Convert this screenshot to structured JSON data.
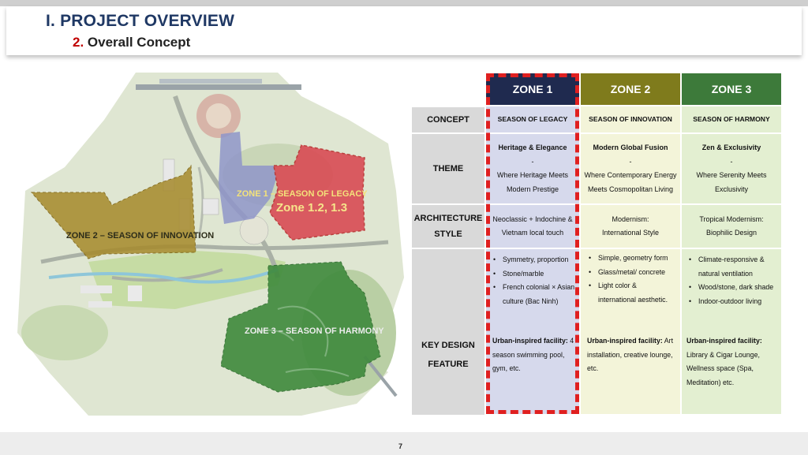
{
  "header": {
    "title": "I. PROJECT OVERVIEW",
    "subtitle_num": "2.",
    "subtitle": "Overall Concept"
  },
  "map": {
    "zone1_label": "ZONE 1 – SEASON OF LEGACY",
    "zone1_sub": "Zone 1.2, 1.3",
    "zone2_label": "ZONE 2 – SEASON OF INNOVATION",
    "zone3_label": "ZONE 3 – SEASON OF HARMONY"
  },
  "table": {
    "zones": [
      "ZONE 1",
      "ZONE 2",
      "ZONE 3"
    ],
    "zone_colors": [
      "#1f2a4f",
      "#7f7b1c",
      "#3d7a3a"
    ],
    "row_labels": {
      "concept": "CONCEPT",
      "theme": "THEME",
      "arch_1": "ARCHITECTURE",
      "arch_2": "STYLE",
      "key_1": "KEY DESIGN",
      "key_2": "FEATURE"
    },
    "concept": [
      "SEASON OF LEGACY",
      "SEASON OF INNOVATION",
      "SEASON OF HARMONY"
    ],
    "theme": [
      {
        "title": "Heritage & Elegance",
        "dash": "-",
        "line1": "Where Heritage Meets",
        "line2": "Modern Prestige"
      },
      {
        "title": "Modern Global Fusion",
        "dash": "-",
        "line1": "Where Contemporary Energy",
        "line2": "Meets Cosmopolitan Living"
      },
      {
        "title": "Zen & Exclusivity",
        "dash": "-",
        "line1": "Where Serenity Meets",
        "line2": "Exclusivity"
      }
    ],
    "arch": [
      {
        "line1": "Neoclassic + Indochine &",
        "line2": "Vietnam local touch"
      },
      {
        "line1": "Modernism:",
        "line2": "International  Style"
      },
      {
        "line1": "Tropical Modernism:",
        "line2": "Biophilic Design"
      }
    ],
    "key": [
      {
        "bullets": [
          "Symmetry, proportion",
          "Stone/marble",
          "French colonial × Asian",
          "culture (Bac Ninh)"
        ],
        "facility_label": "Urban-inspired facility:",
        "facility_text1": " 4",
        "facility_text2": "season swimming pool,",
        "facility_text3": "gym, etc."
      },
      {
        "bullets": [
          "Simple, geometry form",
          "Glass/metal/ concrete",
          "Light color &",
          "international aesthetic."
        ],
        "facility_label": "Urban-inspired facility:",
        "facility_text1": " Art",
        "facility_text2": "installation, creative lounge,",
        "facility_text3": "etc."
      },
      {
        "bullets": [
          "Climate-responsive &",
          "natural ventilation",
          "Wood/stone,  dark shade",
          "Indoor-outdoor living"
        ],
        "facility_label": "Urban-inspired facility:",
        "facility_text1": "",
        "facility_text2": "Library & Cigar Lounge,",
        "facility_text3": "Wellness space (Spa,",
        "facility_text4": "Meditation) etc."
      }
    ]
  },
  "footer": {
    "page": "7"
  }
}
